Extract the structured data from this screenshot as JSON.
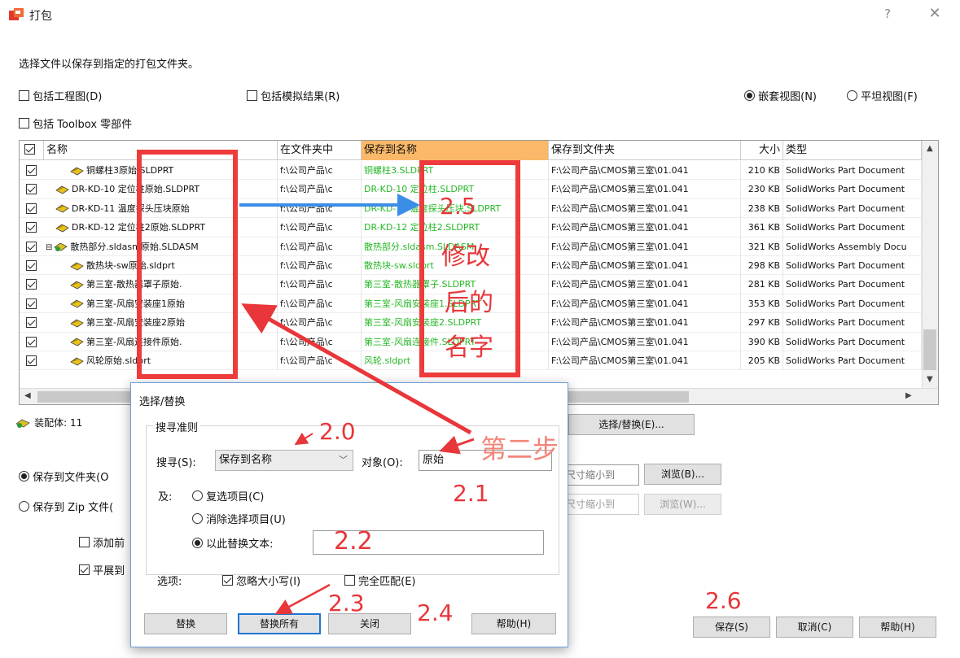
{
  "window": {
    "title": "打包",
    "help_glyph": "?",
    "close_glyph": "✕"
  },
  "instruction": "选择文件以保存到指定的打包文件夹。",
  "options": {
    "include_drawings": "包括工程图(D)",
    "include_simulation": "包括模拟结果(R)",
    "include_toolbox": "包括 Toolbox 零部件",
    "nested_view": "嵌套视图(N)",
    "flat_view": "平坦视图(F)"
  },
  "table": {
    "headers": [
      "名称",
      "在文件夹中",
      "保存到名称",
      "保存到文件夹",
      "大小",
      "类型"
    ],
    "rows": [
      {
        "name": "铜螺柱3原始.SLDPRT",
        "folder": "f:\\公司产品\\c",
        "save_name": "铜螺柱3.SLDPRT",
        "save_folder": "F:\\公司产品\\CMOS第三室\\01.041",
        "size": "210 KB",
        "type": "SolidWorks Part Document",
        "indent": 2,
        "icon": "part"
      },
      {
        "name": "DR-KD-10 定位柱原始.SLDPRT",
        "folder": "f:\\公司产品\\c",
        "save_name": "DR-KD-10 定位柱.SLDPRT",
        "save_folder": "F:\\公司产品\\CMOS第三室\\01.041",
        "size": "230 KB",
        "type": "SolidWorks Part Document",
        "indent": 1,
        "icon": "part"
      },
      {
        "name": "DR-KD-11 温度探头压块原始",
        "folder": "f:\\公司产品\\c",
        "save_name": "DR-KD-11 温度探头压块.SLDPRT",
        "save_folder": "F:\\公司产品\\CMOS第三室\\01.041",
        "size": "238 KB",
        "type": "SolidWorks Part Document",
        "indent": 1,
        "icon": "part"
      },
      {
        "name": "DR-KD-12 定位柱2原始.SLDPRT",
        "folder": "f:\\公司产品\\c",
        "save_name": "DR-KD-12 定位柱2.SLDPRT",
        "save_folder": "F:\\公司产品\\CMOS第三室\\01.041",
        "size": "361 KB",
        "type": "SolidWorks Part Document",
        "indent": 1,
        "icon": "part"
      },
      {
        "name": "散热部分.sldasm原始.SLDASM",
        "folder": "f:\\公司产品\\c",
        "save_name": "散热部分.sldasm.SLDASM",
        "save_folder": "F:\\公司产品\\CMOS第三室\\01.041",
        "size": "321 KB",
        "type": "SolidWorks Assembly Docu",
        "indent": 1,
        "icon": "asm",
        "expander": "⊟"
      },
      {
        "name": "散热块-sw原始.sldprt",
        "folder": "f:\\公司产品\\c",
        "save_name": "散热块-sw.sldprt",
        "save_folder": "F:\\公司产品\\CMOS第三室\\01.041",
        "size": "298 KB",
        "type": "SolidWorks Part Document",
        "indent": 2,
        "icon": "part"
      },
      {
        "name": "第三室-散热器罩子原始.",
        "folder": "f:\\公司产品\\c",
        "save_name": "第三室-散热器罩子.SLDPRT",
        "save_folder": "F:\\公司产品\\CMOS第三室\\01.041",
        "size": "281 KB",
        "type": "SolidWorks Part Document",
        "indent": 2,
        "icon": "part"
      },
      {
        "name": "第三室-风扇安装座1原始",
        "folder": "f:\\公司产品\\c",
        "save_name": "第三室-风扇安装座1.SLDPRT",
        "save_folder": "F:\\公司产品\\CMOS第三室\\01.041",
        "size": "353 KB",
        "type": "SolidWorks Part Document",
        "indent": 2,
        "icon": "part"
      },
      {
        "name": "第三室-风扇安装座2原始",
        "folder": "f:\\公司产品\\c",
        "save_name": "第三室-风扇安装座2.SLDPRT",
        "save_folder": "F:\\公司产品\\CMOS第三室\\01.041",
        "size": "297 KB",
        "type": "SolidWorks Part Document",
        "indent": 2,
        "icon": "part"
      },
      {
        "name": "第三室-风扇连接件原始.",
        "folder": "f:\\公司产品\\c",
        "save_name": "第三室-风扇连接件.SLDPRT",
        "save_folder": "F:\\公司产品\\CMOS第三室\\01.041",
        "size": "390 KB",
        "type": "SolidWorks Part Document",
        "indent": 2,
        "icon": "part"
      },
      {
        "name": "风轮原始.sldprt",
        "folder": "f:\\公司产品\\c",
        "save_name": "风轮.sldprt",
        "save_folder": "F:\\公司产品\\CMOS第三室\\01.041",
        "size": "205 KB",
        "type": "SolidWorks Part Document",
        "indent": 2,
        "icon": "part"
      }
    ]
  },
  "summary": {
    "assemblies": "装配体: 11"
  },
  "bottom": {
    "select_replace": "选择/替换(E)...",
    "save_to_folder": "保存到文件夹(O",
    "save_to_zip": "保存到 Zip 文件(",
    "add_prefix": "添加前",
    "flatten": "平展到",
    "path1_value": "尺寸缩小到",
    "path2_value": "尺寸缩小到",
    "browse1": "浏览(B)...",
    "browse2": "浏览(W)...",
    "save": "保存(S)",
    "cancel": "取消(C)",
    "help": "帮助(H)"
  },
  "dialog": {
    "title": "选择/替换",
    "group_title": "搜寻准则",
    "search_label": "搜寻(S):",
    "search_value": "保存到名称",
    "object_label": "对象(O):",
    "object_value": "原始",
    "and_label": "及:",
    "opt_check": "复选项目(C)",
    "opt_uncheck": "消除选择项目(U)",
    "opt_replace": "以此替换文本:",
    "replace_value": "",
    "options_label": "选项:",
    "ignore_case": "忽略大小写(I)",
    "whole_match": "完全匹配(E)",
    "btn_replace": "替换",
    "btn_replace_all": "替换所有",
    "btn_close": "关闭",
    "btn_help": "帮助(H)"
  },
  "annotations": {
    "a20": "2.0",
    "a21": "2.1",
    "a22": "2.2",
    "a23": "2.3",
    "a24": "2.4",
    "a25": "2.5",
    "a26": "2.6",
    "modified_1": "修改",
    "modified_2": "后的",
    "modified_3": "名字",
    "step2": "第二步"
  },
  "colors": {
    "accent": "#1e74d6",
    "highlight_header": "#fbb868",
    "annotation_red": "#e8363a",
    "green_text": "#26b826",
    "arrow_blue": "#3a8ee6"
  }
}
